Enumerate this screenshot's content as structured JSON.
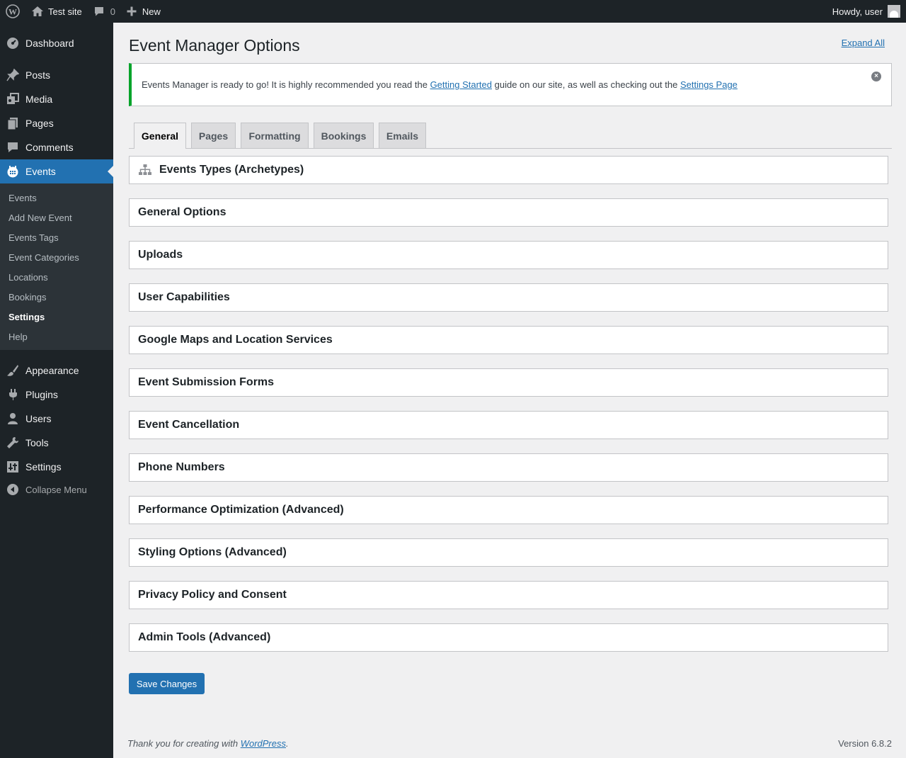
{
  "admin_bar": {
    "site_name": "Test site",
    "comments_count": "0",
    "new_label": "New",
    "greeting": "Howdy, user"
  },
  "sidebar": {
    "top_items": [
      {
        "label": "Dashboard",
        "icon": "dashboard-icon"
      },
      {
        "label": "Posts",
        "icon": "pin-icon"
      },
      {
        "label": "Media",
        "icon": "media-icon"
      },
      {
        "label": "Pages",
        "icon": "pages-icon"
      },
      {
        "label": "Comments",
        "icon": "comment-icon"
      },
      {
        "label": "Events",
        "icon": "calendar-icon",
        "current": true
      }
    ],
    "submenu": [
      "Events",
      "Add New Event",
      "Events Tags",
      "Event Categories",
      "Locations",
      "Bookings",
      "Settings",
      "Help"
    ],
    "submenu_current": "Settings",
    "bottom_items": [
      {
        "label": "Appearance",
        "icon": "brush-icon"
      },
      {
        "label": "Plugins",
        "icon": "plugin-icon"
      },
      {
        "label": "Users",
        "icon": "users-icon"
      },
      {
        "label": "Tools",
        "icon": "wrench-icon"
      },
      {
        "label": "Settings",
        "icon": "settings-icon"
      }
    ],
    "collapse_label": "Collapse Menu"
  },
  "page": {
    "title": "Event Manager Options",
    "expand_all": "Expand All",
    "notice": {
      "text_before": "Events Manager is ready to go! It is highly recommended you read the ",
      "link1": "Getting Started",
      "text_middle": " guide on our site, as well as checking out the ",
      "link2": "Settings Page"
    },
    "tabs": [
      "General",
      "Pages",
      "Formatting",
      "Bookings",
      "Emails"
    ],
    "active_tab": "General",
    "sections": [
      "Events Types (Archetypes)",
      "General Options",
      "Uploads",
      "User Capabilities",
      "Google Maps and Location Services",
      "Event Submission Forms",
      "Event Cancellation",
      "Phone Numbers",
      "Performance Optimization (Advanced)",
      "Styling Options (Advanced)",
      "Privacy Policy and Consent",
      "Admin Tools (Advanced)"
    ],
    "save_label": "Save Changes"
  },
  "footer": {
    "thanks_before": "Thank you for creating with ",
    "thanks_link": "WordPress",
    "thanks_after": ".",
    "version": "Version 6.8.2"
  },
  "colors": {
    "admin_dark": "#1d2327",
    "accent_blue": "#2271b1",
    "notice_green": "#00a32a",
    "background": "#f0f0f1"
  }
}
